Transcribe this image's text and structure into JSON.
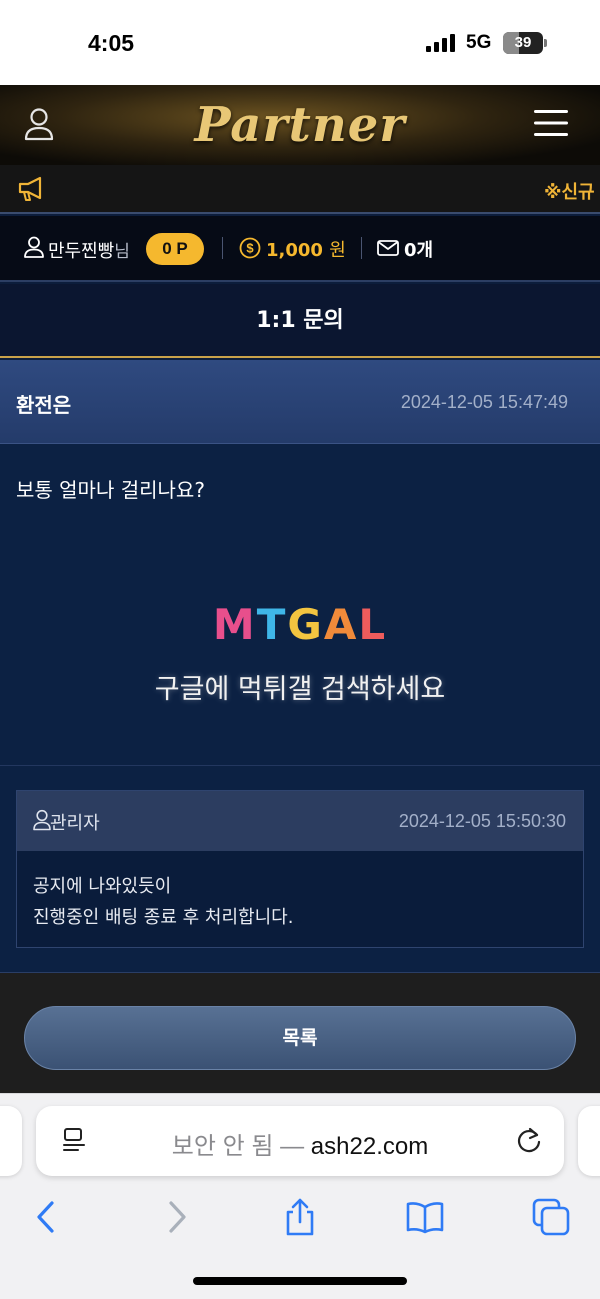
{
  "status_bar": {
    "time": "4:05",
    "network": "5G",
    "battery": "39",
    "battery_level": 0.39
  },
  "header": {
    "logo": "Partner",
    "icons": [
      "user-icon",
      "menu-icon"
    ]
  },
  "notice": {
    "icon": "megaphone-icon",
    "text": "※신규"
  },
  "account": {
    "username": "만두찐빵",
    "honorific": "님",
    "points": "0 P",
    "money": "1,000",
    "money_unit": "원",
    "messages": "0개"
  },
  "page": {
    "title": "1:1 문의"
  },
  "question": {
    "title": "환전은",
    "date": "2024-12-05 15:47:49",
    "body": "보통 얼마나 걸리나요?"
  },
  "watermark": {
    "logo_letters": [
      "M",
      "T",
      "G",
      "A",
      "L"
    ],
    "text": "구글에 먹튀갤 검색하세요"
  },
  "answer": {
    "author": "관리자",
    "date": "2024-12-05 15:50:30",
    "line1": "공지에 나와있듯이",
    "line2": "진행중인 배팅 종료 후 처리합니다."
  },
  "actions": {
    "list_label": "목록"
  },
  "browser": {
    "security_warning": "보안 안 됨 — ",
    "domain": "ash22.com",
    "nav_icons": [
      "back-icon",
      "forward-icon",
      "share-icon",
      "bookmarks-icon",
      "tabs-icon"
    ]
  },
  "colors": {
    "accent_gold": "#f5b82e",
    "header_blue": "#2f4a80",
    "body_navy": "#0c2143"
  }
}
